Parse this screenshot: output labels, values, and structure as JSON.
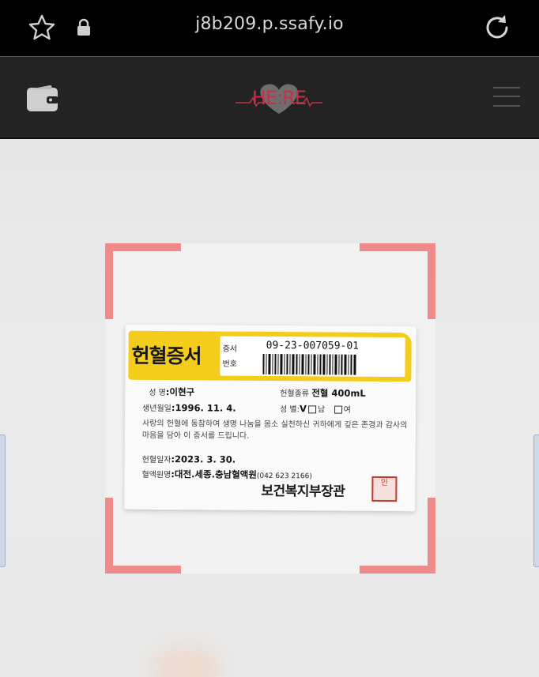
{
  "browser": {
    "url": "j8b209.p.ssafy.io"
  },
  "app": {
    "logo_text": "HE:RE",
    "brand_color": "#c43049"
  },
  "scanner": {
    "frame_color": "#ef8a8a"
  },
  "certificate": {
    "title": "헌혈증서",
    "cert_label_1": "증서",
    "cert_label_2": "번호",
    "cert_number": "09-23-007059-01",
    "name_label": "성    명",
    "name_value": ":이현구",
    "donation_type_label": "헌혈종류",
    "donation_type_value": "전혈 400mL",
    "birth_label": "생년월일",
    "birth_value": ":1996. 11. 4.",
    "sex_label": "성    별",
    "sex_male": "남",
    "sex_female": "여",
    "message": "사랑의 헌혈에 동참하여 생명 나눔을 몸소 실천하신 귀하에게 깊은 존경과 감사의 마음을 담아 이 증서를 드립니다.",
    "date_label": "헌혈일자",
    "date_value": ":2023. 3. 30.",
    "center_label": "혈액원명",
    "center_value": ":대전.세종.충남혈액원",
    "center_phone": "(042 623 2166)",
    "issuer": "보건복지부장관",
    "seal_text": "인"
  }
}
